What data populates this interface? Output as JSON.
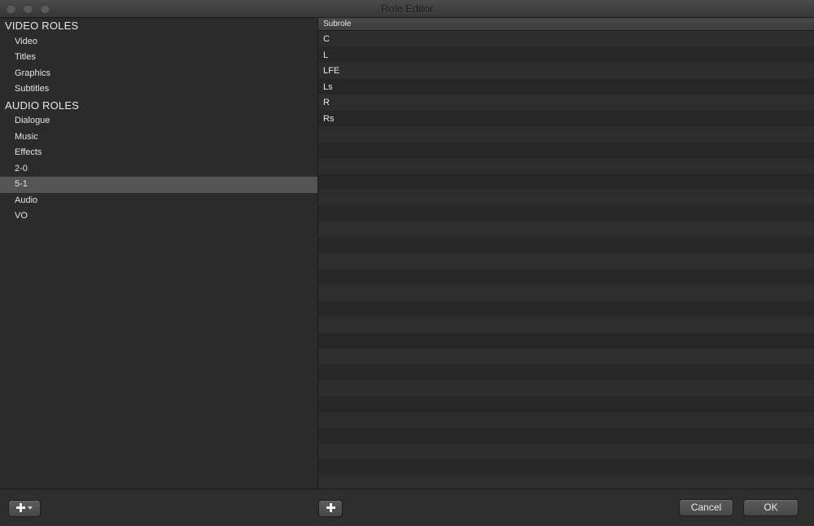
{
  "window": {
    "title": "Role Editor"
  },
  "video_roles": {
    "header": "VIDEO ROLES",
    "items": [
      "Video",
      "Titles",
      "Graphics",
      "Subtitles"
    ]
  },
  "audio_roles": {
    "header": "AUDIO ROLES",
    "items": [
      "Dialogue",
      "Music",
      "Effects",
      "2-0",
      "5-1",
      "Audio",
      "VO"
    ],
    "selected": "5-1"
  },
  "subroles": {
    "column_header": "Subrole",
    "items": [
      "C",
      "L",
      "LFE",
      "Ls",
      "R",
      "Rs"
    ]
  },
  "buttons": {
    "cancel": "Cancel",
    "ok": "OK"
  },
  "icons": {
    "add_role": "plus-icon",
    "add_role_menu": "caret-down-icon",
    "add_subrole": "plus-icon"
  },
  "colors": {
    "selection": "#555555",
    "background": "#2b2b2b"
  }
}
